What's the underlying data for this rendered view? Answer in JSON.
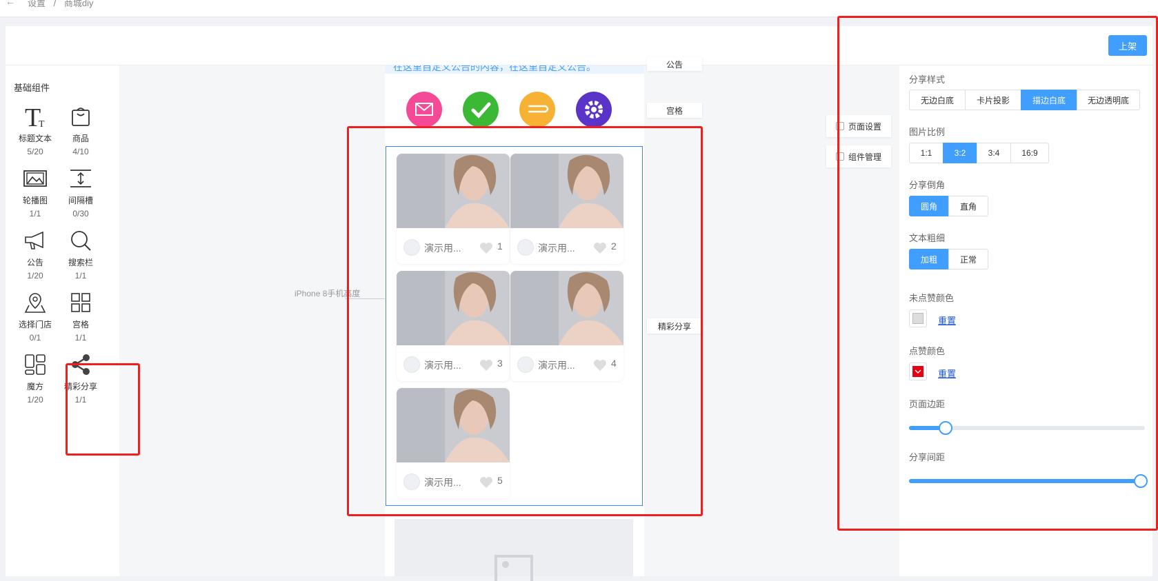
{
  "breadcrumb": {
    "back_icon": "arrow-left-icon",
    "items": [
      "设置",
      "/",
      "商城diy"
    ]
  },
  "header": {
    "publish_label": "上架"
  },
  "sidebar": {
    "title": "基础组件",
    "components": [
      {
        "name": "标题文本",
        "count": "5/20",
        "icon": "title-text-icon"
      },
      {
        "name": "商品",
        "count": "4/10",
        "icon": "goods-icon"
      },
      {
        "name": "轮播图",
        "count": "1/1",
        "icon": "carousel-icon"
      },
      {
        "name": "间隔槽",
        "count": "0/30",
        "icon": "spacer-icon"
      },
      {
        "name": "公告",
        "count": "1/20",
        "icon": "notice-icon"
      },
      {
        "name": "搜索栏",
        "count": "1/1",
        "icon": "search-icon"
      },
      {
        "name": "选择门店",
        "count": "0/1",
        "icon": "store-location-icon"
      },
      {
        "name": "宫格",
        "count": "1/1",
        "icon": "grid-icon"
      },
      {
        "name": "魔方",
        "count": "1/20",
        "icon": "cube-layout-icon"
      },
      {
        "name": "精彩分享",
        "count": "1/1",
        "icon": "share-icon"
      }
    ]
  },
  "canvas": {
    "iphone_label": "iPhone 8手机高度",
    "notice_text": "在这里自定义公告的内容，在这里自定义公告。",
    "nav_icons": [
      "mail-icon",
      "check-icon",
      "ribbon-icon",
      "gear-icon"
    ],
    "tags": {
      "notice": "公告",
      "grid": "宫格",
      "share": "精彩分享"
    },
    "side_buttons": {
      "page_settings": "页面设置",
      "component_manage": "组件管理"
    },
    "share_items": [
      {
        "user": "演示用...",
        "likes": "1"
      },
      {
        "user": "演示用...",
        "likes": "2"
      },
      {
        "user": "演示用...",
        "likes": "3"
      },
      {
        "user": "演示用...",
        "likes": "4"
      },
      {
        "user": "演示用...",
        "likes": "5"
      }
    ]
  },
  "panel": {
    "share_style": {
      "label": "分享样式",
      "options": [
        "无边白底",
        "卡片投影",
        "描边白底",
        "无边透明底"
      ],
      "selected": "描边白底"
    },
    "image_ratio": {
      "label": "图片比例",
      "options": [
        "1:1",
        "3:2",
        "3:4",
        "16:9"
      ],
      "selected": "3:2"
    },
    "corner": {
      "label": "分享倒角",
      "options": [
        "圆角",
        "直角"
      ],
      "selected": "圆角"
    },
    "text_weight": {
      "label": "文本粗细",
      "options": [
        "加粗",
        "正常"
      ],
      "selected": "加粗"
    },
    "unliked_color": {
      "label": "未点赞颜色",
      "reset": "重置",
      "color": "#dddddd"
    },
    "liked_color": {
      "label": "点赞颜色",
      "reset": "重置",
      "color": "#e60012"
    },
    "page_margin": {
      "label": "页面边距",
      "value_fraction": 0.15
    },
    "share_gap": {
      "label": "分享间距",
      "value_fraction": 1.0
    }
  },
  "colors": {
    "accent": "#409eff",
    "annotation": "#f01e1e"
  }
}
